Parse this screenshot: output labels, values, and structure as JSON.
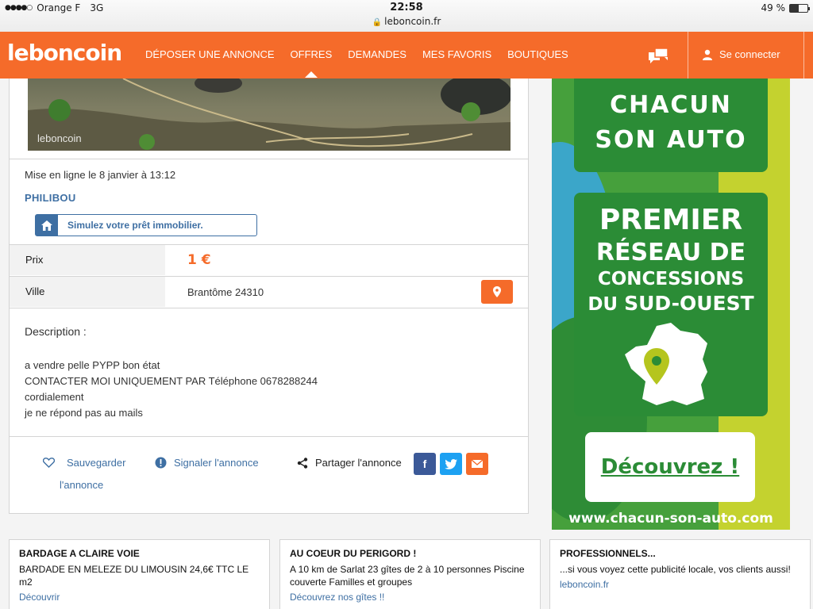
{
  "status": {
    "carrier": "Orange F",
    "network": "3G",
    "time": "22:58",
    "url": "leboncoin.fr",
    "battery": "49 %",
    "battery_level": 0.49
  },
  "header": {
    "logo": "leboncoin",
    "nav": [
      {
        "label": "DÉPOSER UNE ANNONCE"
      },
      {
        "label": "OFFRES"
      },
      {
        "label": "DEMANDES"
      },
      {
        "label": "MES FAVORIS"
      },
      {
        "label": "BOUTIQUES"
      }
    ],
    "login": "Se connecter",
    "accent": "#f56b2a"
  },
  "listing": {
    "photo_watermark": "leboncoin",
    "posted": "Mise en ligne le 8 janvier à 13:12",
    "seller": "PHILIBOU",
    "loan_label": "Simulez votre prêt immobilier.",
    "price_label": "Prix",
    "price": "1 €",
    "city_label": "Ville",
    "city": "Brantôme 24310",
    "description_title": "Description :",
    "description_lines": [
      "a vendre pelle PYPP bon état",
      "CONTACTER MOI UNIQUEMENT PAR Téléphone 0678288244",
      "cordialement",
      "je ne répond pas au mails"
    ],
    "save_line1": "Sauvegarder",
    "save_line2": "l'annonce",
    "report": "Signaler l'annonce",
    "share": "Partager l'annonce",
    "facebook_letter": "f"
  },
  "ad": {
    "line1": "CHACUN",
    "line2": "SON AUTO",
    "line3": "PREMIER",
    "line4": "RÉSEAU DE",
    "line5": "CONCESSIONS",
    "line6a": "DU ",
    "line6b": "SUD-OUEST",
    "button": "Découvrez !",
    "url": "www.chacun-son-auto.com"
  },
  "bottom_ads": [
    {
      "title": "BARDAGE A CLAIRE VOIE",
      "text": "BARDADE EN MELEZE DU LIMOUSIN 24,6€ TTC LE m2",
      "link": "Découvrir"
    },
    {
      "title": "AU COEUR DU PERIGORD !",
      "text": "A 10 km de Sarlat 23 gîtes de 2 à 10 personnes Piscine couverte Familles et groupes",
      "link": "Découvrez nos gîtes !!"
    },
    {
      "title": "PROFESSIONNELS...",
      "text": "...si vous voyez cette publicité locale, vos clients aussi!",
      "link": "leboncoin.fr"
    }
  ]
}
